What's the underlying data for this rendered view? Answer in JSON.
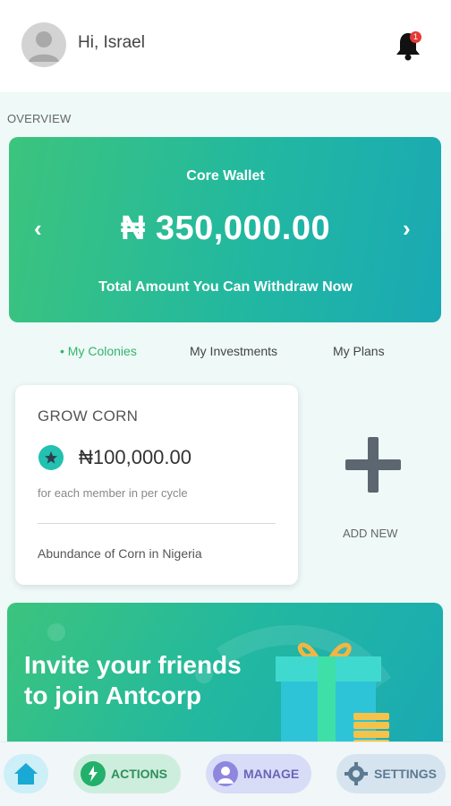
{
  "header": {
    "greeting": "Hi, Israel",
    "notification_count": "1"
  },
  "overview_label": "OVERVIEW",
  "wallet": {
    "title": "Core Wallet",
    "amount": "₦ 350,000.00",
    "subtitle": "Total Amount You Can Withdraw Now"
  },
  "tabs": [
    {
      "label": "My Colonies",
      "active": true
    },
    {
      "label": "My Investments",
      "active": false
    },
    {
      "label": "My Plans",
      "active": false
    }
  ],
  "colony": {
    "title": "GROW CORN",
    "amount": "₦100,000.00",
    "note": "for each member in per cycle",
    "description": "Abundance of Corn in Nigeria"
  },
  "add_new_label": "ADD NEW",
  "invite": {
    "text": "Invite your friends to join Antcorp"
  },
  "bottom_nav": {
    "actions": "ACTIONS",
    "manage": "MANAGE",
    "settings": "SETTINGS"
  },
  "colors": {
    "brand_green": "#3cc47d",
    "brand_teal": "#1aa9b4",
    "active_tab": "#34b56a",
    "badge_red": "#e53935"
  },
  "icons": [
    "avatar-icon",
    "bell-icon",
    "chevron-left-icon",
    "chevron-right-icon",
    "star-icon",
    "plus-icon",
    "gift-icon",
    "home-icon",
    "bolt-icon",
    "user-icon",
    "gear-icon"
  ]
}
